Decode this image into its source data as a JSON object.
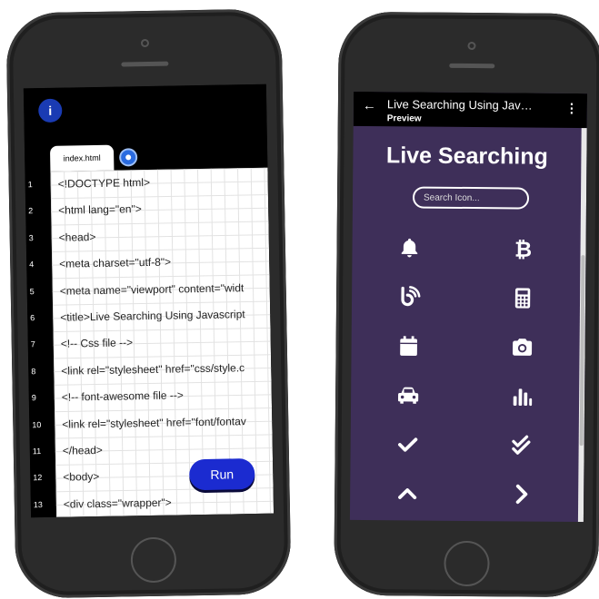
{
  "editor": {
    "menu_icon_glyph": "i",
    "tab_label": "index.html",
    "run_label": "Run",
    "line_numbers": [
      "1",
      "2",
      "3",
      "4",
      "5",
      "6",
      "7",
      "8",
      "9",
      "10",
      "11",
      "12",
      "13"
    ],
    "lines": [
      "<!DOCTYPE html>",
      "<html lang=\"en\">",
      "<head>",
      "<meta charset=\"utf-8\">",
      "<meta name=\"viewport\" content=\"widt",
      "<title>Live Searching Using Javascript",
      "<!-- Css file -->",
      "<link rel=\"stylesheet\" href=\"css/style.c",
      "<!-- font-awesome file -->",
      "<link rel=\"stylesheet\" href=\"font/fontav",
      "</head>",
      "<body>",
      "<div class=\"wrapper\">"
    ]
  },
  "preview": {
    "title": "Live Searching Using Jav…",
    "subtitle": "Preview",
    "back_glyph": "←",
    "more_glyph": "⋮",
    "heading": "Live Searching",
    "search_placeholder": "Search Icon...",
    "icons": [
      "bell-icon",
      "bitcoin-icon",
      "blogger-icon",
      "calculator-icon",
      "calendar-icon",
      "camera-icon",
      "car-icon",
      "chart-bar-icon",
      "check-icon",
      "check-double-icon",
      "chevron-up-icon",
      "chevron-right-icon"
    ]
  },
  "colors": {
    "editor_accent": "#1b2bd0",
    "preview_bg": "#3e2f59",
    "phone_body": "#2b2b2b"
  }
}
